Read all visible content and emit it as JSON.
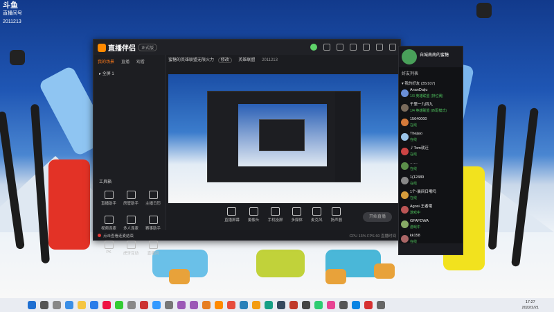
{
  "overlay_logo": {
    "brand": "斗鱼",
    "sub": "直播间号",
    "room": "2011213"
  },
  "app": {
    "title": "直播伴侣",
    "edition": "正式版",
    "left_tabs": [
      "我的场景",
      "直播",
      "观看"
    ],
    "scene": "全屏 1",
    "toolbox_title": "工具箱",
    "tools": [
      {
        "icon": "copilot-icon",
        "label": "直播助手"
      },
      {
        "icon": "fan-icon",
        "label": "房管助手"
      },
      {
        "icon": "schedule-icon",
        "label": "主播日历"
      },
      {
        "icon": "video-icon",
        "label": "视频连麦"
      },
      {
        "icon": "multi-user-icon",
        "label": "多人连麦"
      },
      {
        "icon": "gift-icon",
        "label": "赛事助手"
      },
      {
        "icon": "pk-icon",
        "label": "PK"
      },
      {
        "icon": "game-icon",
        "label": "虎牙互动"
      },
      {
        "icon": "more-icon",
        "label": "直播间"
      }
    ],
    "room_title": "蜜糖的英雄联盟无限火力",
    "edit_label": "修改",
    "category_label": "英雄联盟",
    "room_id": "2011213",
    "controls": [
      {
        "icon": "screen-icon",
        "label": "直播屏幕"
      },
      {
        "icon": "camera-icon",
        "label": "摄像头"
      },
      {
        "icon": "phone-icon",
        "label": "手机投屏"
      },
      {
        "icon": "media-icon",
        "label": "多媒体"
      },
      {
        "icon": "mic-icon",
        "label": "麦克风"
      },
      {
        "icon": "speaker-icon",
        "label": "扬声器"
      }
    ],
    "start_button": "开始直播",
    "status_warning": "点击查看连麦结束",
    "status_right": "CPU 13%  FPS 60  直播时间"
  },
  "chat": {
    "name": "白城南南的蜜糖",
    "subtitle": "好友列表",
    "group": "我的好友 (35/107)",
    "friends": [
      {
        "name": "AnanDaiju",
        "status": "1/3 英雄联盟 (排位赛)",
        "color": "#6a8fd8"
      },
      {
        "name": "千里一九四九",
        "status": "1/4 英雄联盟 (匹配模式)",
        "color": "#7a6b5c"
      },
      {
        "name": "15640000",
        "status": "在线",
        "color": "#d47a3a"
      },
      {
        "name": "Thejiao",
        "status": "在线",
        "color": "#9ac4e8"
      },
      {
        "name": "丿Tom就汪",
        "status": "在线",
        "color": "#c44"
      },
      {
        "name": "……",
        "status": "在线",
        "color": "#5b8f4a"
      },
      {
        "name": "1(12489",
        "status": "在线",
        "color": "#888"
      },
      {
        "name": "1个·晨间日哦吗",
        "status": "在线",
        "color": "#d69c3b"
      },
      {
        "name": "Agosi·王者哦",
        "status": "游戏中",
        "color": "#b55"
      },
      {
        "name": "GFAFDWA",
        "status": "游戏中",
        "color": "#8a6"
      },
      {
        "name": "kk158",
        "status": "在线",
        "color": "#a66"
      }
    ]
  },
  "taskbar": {
    "time": "17:27",
    "date": "2022/2/21"
  }
}
